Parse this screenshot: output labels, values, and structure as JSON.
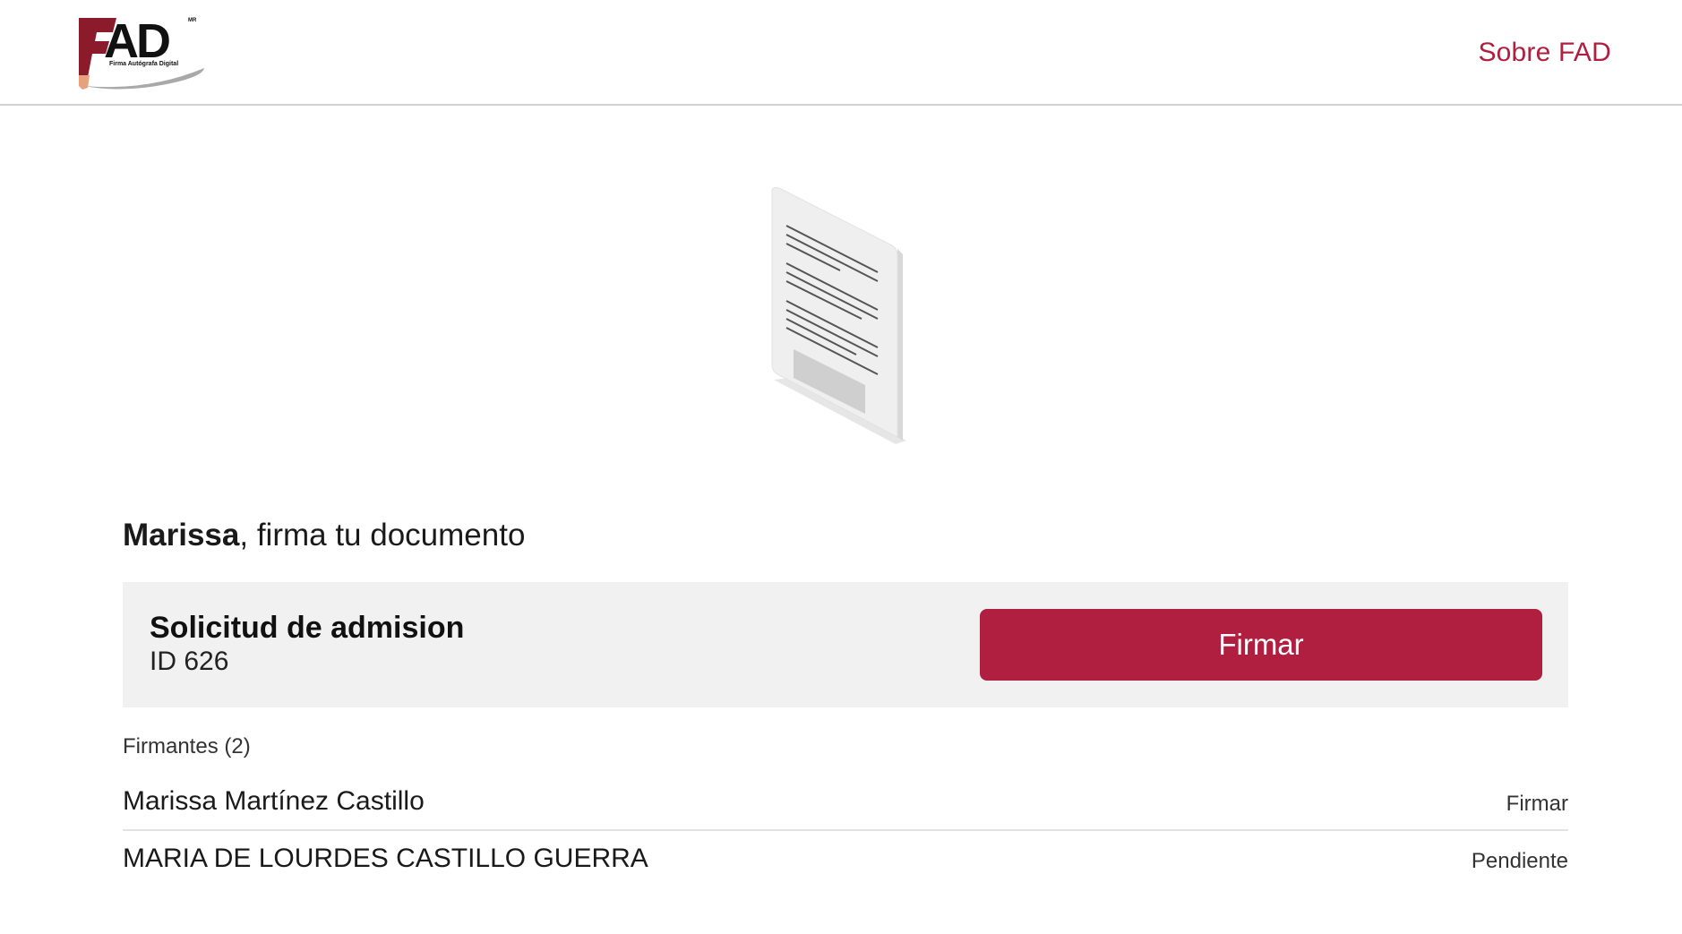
{
  "header": {
    "logo": {
      "wordmark": "FAD",
      "tagline": "Firma Autógrafa Digital",
      "mark": "MR"
    },
    "nav_link": "Sobre FAD"
  },
  "illustration": {
    "icon": "document-illustration"
  },
  "greeting": {
    "name": "Marissa",
    "text": ", firma tu documento"
  },
  "document": {
    "title": "Solicitud de admision",
    "id": "ID 626",
    "sign_button": "Firmar"
  },
  "signers": {
    "heading": "Firmantes (2)",
    "items": [
      {
        "name": "Marissa Martínez Castillo",
        "status": "Firmar"
      },
      {
        "name": "MARIA DE LOURDES CASTILLO GUERRA",
        "status": "Pendiente"
      }
    ]
  },
  "colors": {
    "brand": "#b01f3f",
    "logo_red": "#8b1a2b",
    "card_bg": "#f1f1f1"
  }
}
